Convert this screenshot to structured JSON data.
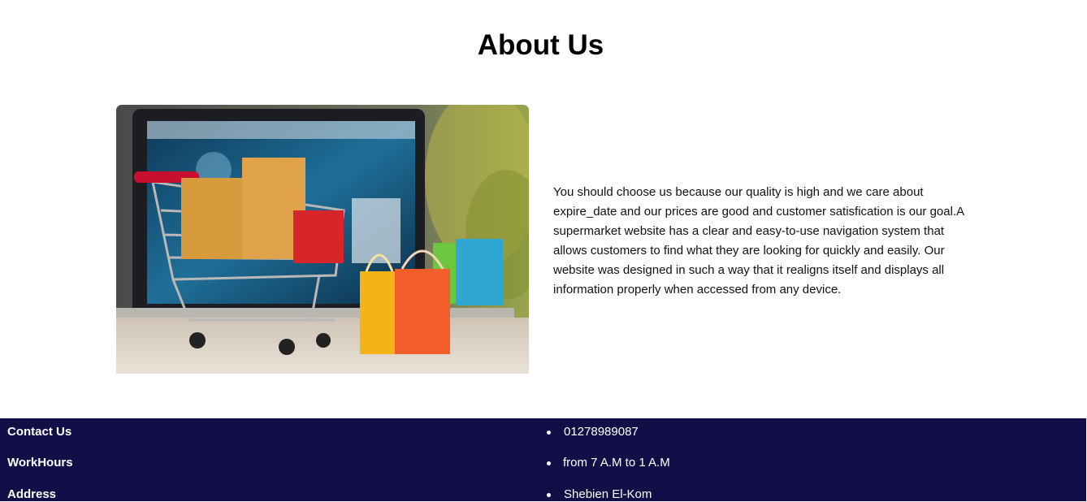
{
  "about": {
    "title": "About Us",
    "description": "You should choose us because our quality is high and we care about expire_date and our prices are good and customer satisfication is our goal.A supermarket website has a clear and easy-to-use navigation system that allows customers to find what they are looking for quickly and easily. Our website was designed in such a way that it realigns itself and displays all information properly when accessed from any device."
  },
  "footer": {
    "background": "#120f48",
    "items": [
      {
        "label": "Contact Us",
        "value": "01278989087"
      },
      {
        "label": "WorkHours",
        "value": "from 7 A.M to 1 A.M"
      },
      {
        "label": "Address",
        "value": "Shebien El-Kom"
      }
    ]
  }
}
